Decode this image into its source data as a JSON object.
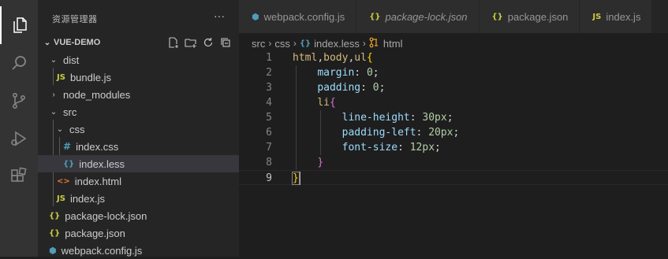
{
  "colors": {
    "activity_bar": "#333333",
    "sidebar_bg": "#252526",
    "editor_bg": "#1e1e1e",
    "selected_row": "#37373d",
    "selector": "#d7ba7d",
    "property": "#9cdcfe",
    "number": "#b5cea8",
    "bracket_level1": "#ffd700",
    "bracket_level2": "#da70d6"
  },
  "activity_bar": {
    "icons": [
      "explorer-icon",
      "search-icon",
      "source-control-icon",
      "run-debug-icon",
      "extensions-icon"
    ]
  },
  "sidebar": {
    "title": "资源管理器",
    "more": "···",
    "project": "VUE-DEMO",
    "project_actions": [
      "new-file-icon",
      "new-folder-icon",
      "refresh-icon",
      "collapse-all-icon"
    ],
    "tree": [
      {
        "name": "dist",
        "type": "folder",
        "expanded": true,
        "indent": 1
      },
      {
        "name": "bundle.js",
        "type": "js",
        "indent": 2
      },
      {
        "name": "node_modules",
        "type": "folder",
        "expanded": false,
        "indent": 1
      },
      {
        "name": "src",
        "type": "folder",
        "expanded": true,
        "indent": 1
      },
      {
        "name": "css",
        "type": "folder",
        "expanded": true,
        "indent": 2
      },
      {
        "name": "index.css",
        "type": "css",
        "indent": 3
      },
      {
        "name": "index.less",
        "type": "less",
        "indent": 3,
        "selected": true
      },
      {
        "name": "index.html",
        "type": "html",
        "indent": 2
      },
      {
        "name": "index.js",
        "type": "js",
        "indent": 2
      },
      {
        "name": "package-lock.json",
        "type": "json",
        "indent": 1
      },
      {
        "name": "package.json",
        "type": "json",
        "indent": 1
      },
      {
        "name": "webpack.config.js",
        "type": "webpack",
        "indent": 1
      }
    ]
  },
  "tabs": [
    {
      "label": "webpack.config.js",
      "icon": "webpack",
      "italic": false
    },
    {
      "label": "package-lock.json",
      "icon": "json",
      "italic": true
    },
    {
      "label": "package.json",
      "icon": "json",
      "italic": false
    },
    {
      "label": "index.js",
      "icon": "js",
      "italic": false
    }
  ],
  "breadcrumb": {
    "items": [
      "src",
      "css",
      "index.less",
      "html"
    ]
  },
  "code": {
    "current_line": 9,
    "lines": [
      {
        "n": "1",
        "tokens": [
          [
            "sel",
            "html"
          ],
          [
            "punc",
            ","
          ],
          [
            "sel",
            "body"
          ],
          [
            "punc",
            ","
          ],
          [
            "sel",
            "ul"
          ],
          [
            "b1",
            "{"
          ]
        ]
      },
      {
        "n": "2",
        "tokens": [
          [
            "ws",
            "    "
          ],
          [
            "prop",
            "margin"
          ],
          [
            "punc",
            ": "
          ],
          [
            "num",
            "0"
          ],
          [
            "punc",
            ";"
          ]
        ]
      },
      {
        "n": "3",
        "tokens": [
          [
            "ws",
            "    "
          ],
          [
            "prop",
            "padding"
          ],
          [
            "punc",
            ": "
          ],
          [
            "num",
            "0"
          ],
          [
            "punc",
            ";"
          ]
        ]
      },
      {
        "n": "4",
        "tokens": [
          [
            "ws",
            "    "
          ],
          [
            "sel",
            "li"
          ],
          [
            "b2",
            "{"
          ]
        ]
      },
      {
        "n": "5",
        "tokens": [
          [
            "ws",
            "        "
          ],
          [
            "prop",
            "line-height"
          ],
          [
            "punc",
            ": "
          ],
          [
            "num",
            "30px"
          ],
          [
            "punc",
            ";"
          ]
        ]
      },
      {
        "n": "6",
        "tokens": [
          [
            "ws",
            "        "
          ],
          [
            "prop",
            "padding-left"
          ],
          [
            "punc",
            ": "
          ],
          [
            "num",
            "20px"
          ],
          [
            "punc",
            ";"
          ]
        ]
      },
      {
        "n": "7",
        "tokens": [
          [
            "ws",
            "        "
          ],
          [
            "prop",
            "font-size"
          ],
          [
            "punc",
            ": "
          ],
          [
            "num",
            "12px"
          ],
          [
            "punc",
            ";"
          ]
        ]
      },
      {
        "n": "8",
        "tokens": [
          [
            "ws",
            "    "
          ],
          [
            "b2",
            "}"
          ]
        ]
      },
      {
        "n": "9",
        "tokens": [
          [
            "b1",
            "}"
          ]
        ]
      }
    ]
  }
}
